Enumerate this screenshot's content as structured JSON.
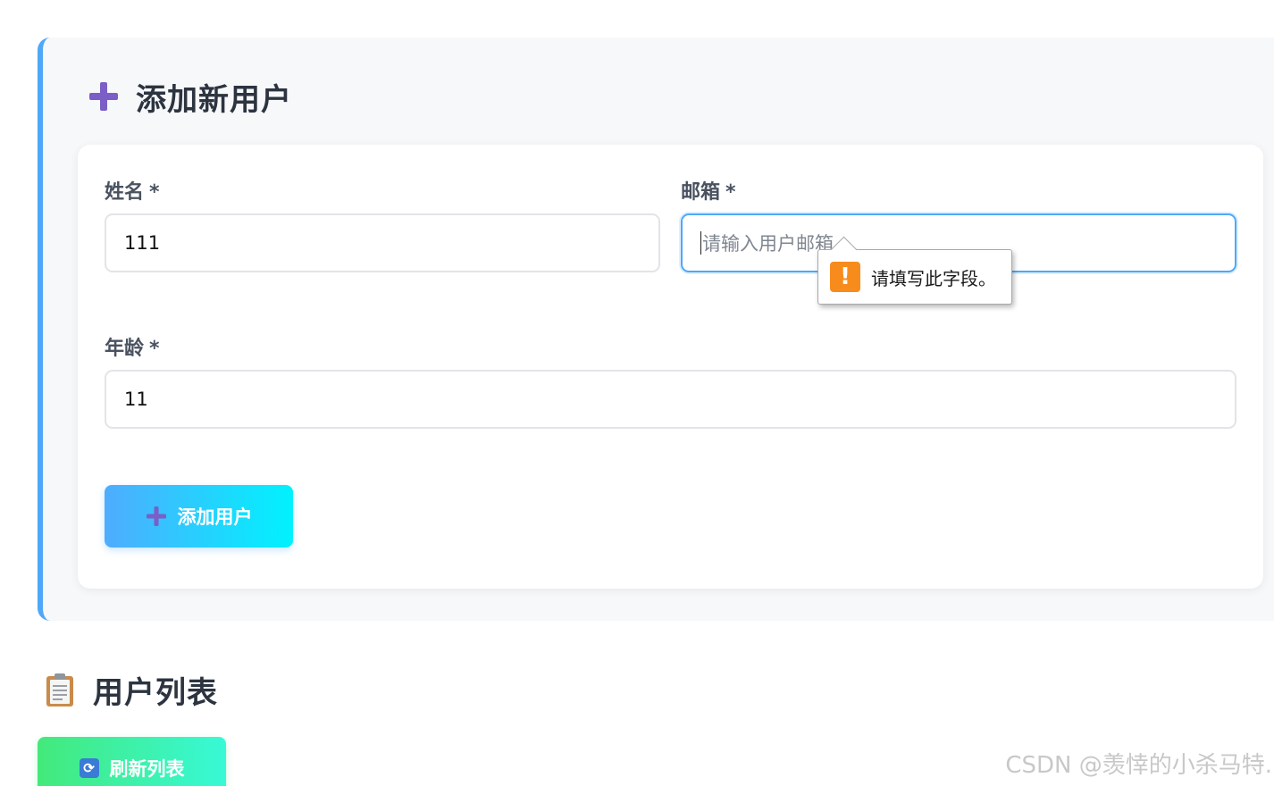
{
  "add_section": {
    "title": "添加新用户",
    "fields": {
      "name": {
        "label": "姓名",
        "required_mark": "*",
        "value": "111"
      },
      "email": {
        "label": "邮箱",
        "required_mark": "*",
        "value": "",
        "placeholder": "请输入用户邮箱"
      },
      "age": {
        "label": "年龄",
        "required_mark": "*",
        "value": "11"
      }
    },
    "validation_tooltip": {
      "icon": "warning-icon",
      "text": "请填写此字段。"
    },
    "submit_button": {
      "icon": "plus-icon",
      "label": "添加用户"
    }
  },
  "list_section": {
    "title": "用户列表",
    "icon": "clipboard-icon",
    "refresh_button": {
      "icon": "refresh-icon",
      "label": "刷新列表"
    }
  },
  "watermark": "CSDN @羡悻的小杀马特.",
  "colors": {
    "accent_border": "#4fa8f7",
    "add_button_gradient": [
      "#4facfe",
      "#00f2fe"
    ],
    "refresh_button_gradient": [
      "#43e97b",
      "#38f9d7"
    ],
    "warning": "#f78c1c",
    "plus_icon": "#7b5ec6"
  }
}
